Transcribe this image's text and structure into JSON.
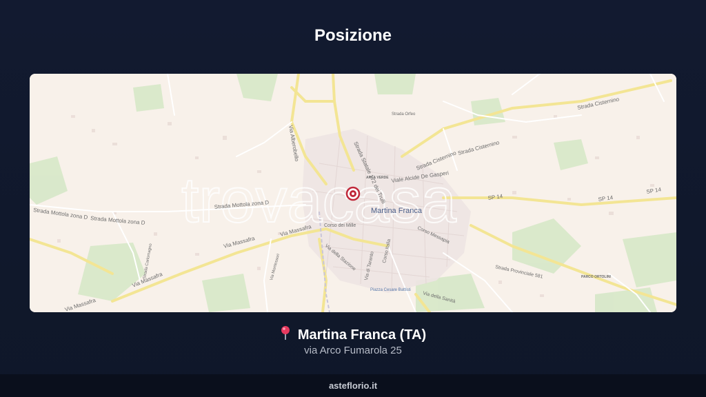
{
  "header": {
    "title": "Posizione"
  },
  "map": {
    "watermark": "trovacasa",
    "labels": {
      "city": "Martina Franca",
      "area_verde": "AREA VERDE",
      "parco": "PARCO ORTOLINI",
      "strada_statale": "Strada Statale 172 dei Trulli",
      "via_alberobello": "Via Alberobello",
      "strada_cisternino_1": "Strada Cisternino",
      "strada_cisternino_2": "Strada Cisternino",
      "strada_cisternino_3": "Strada Cisternino",
      "strada_mottola_1": "Strada Mottola zona D",
      "strada_mottola_2": "Strada Mottola zona D",
      "strada_mottola_3": "Strada Mottola zona D",
      "via_massafra_1": "Via Massafra",
      "via_massafra_2": "Via Massafra",
      "via_massafra_3": "Via Massafra",
      "via_massafra_4": "Via Massafra",
      "via_alcide": "Viale Alcide De Gasperi",
      "sp14_1": "SP 14",
      "sp14_2": "SP 14",
      "sp14_3": "SP 14",
      "corso_mille": "Corso dei Mille",
      "corso_messapia": "Corso Messapia",
      "corso_italia": "Corso Italia",
      "via_stazione": "Via della Stazione",
      "via_taranto": "Via di Taranto",
      "via_della_sanita": "Via della Sanità",
      "strada_provinciale": "Strada Provinciale 581",
      "strada_orfeo": "Strada Orfeo",
      "via_mottola_vert": "Strada Carlomagno",
      "via_montessori": "Via Montessori",
      "piazza": "Piazza Cesare Battisti"
    }
  },
  "location": {
    "pin_icon": "round-pushpin-icon",
    "city": "Martina Franca (TA)",
    "address": "via Arco Fumarola 25"
  },
  "footer": {
    "brand": "asteflorio.it"
  },
  "colors": {
    "background": "#121a30",
    "map_base": "#f8f1ea",
    "road_main": "#f2e28a",
    "park": "#cfe5c3",
    "urban": "#ece4e0",
    "marker": "#c0283a"
  }
}
